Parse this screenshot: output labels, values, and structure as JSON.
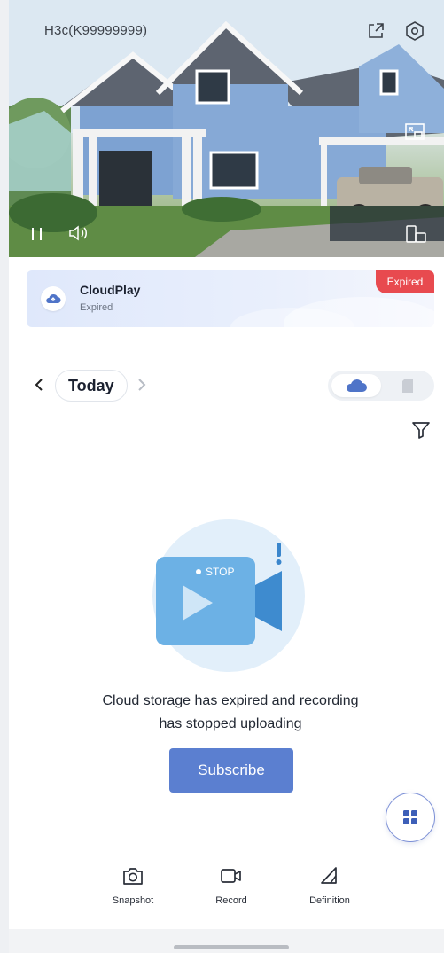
{
  "camera": {
    "title": "H3c(K99999999)",
    "icons": [
      "share-icon",
      "settings-icon",
      "pip-icon",
      "pause-icon",
      "volume-icon",
      "device-switch-icon"
    ]
  },
  "cloud": {
    "title": "CloudPlay",
    "status": "Expired",
    "badge": "Expired"
  },
  "timeline": {
    "date_label": "Today",
    "storage_options": [
      "cloud-icon",
      "sd-card-icon"
    ]
  },
  "empty_state": {
    "illustration_text": "STOP",
    "message_line1": "Cloud storage has expired and recording",
    "message_line2": "has stopped uploading",
    "subscribe_label": "Subscribe"
  },
  "toolbar": {
    "items": [
      {
        "label": "Snapshot",
        "icon": "camera-icon"
      },
      {
        "label": "Record",
        "icon": "video-icon"
      },
      {
        "label": "Definition",
        "icon": "definition-icon"
      }
    ]
  },
  "colors": {
    "accent": "#5b7fd0",
    "badge_red": "#e84a4f",
    "banner_bg": "#e3ebfb"
  }
}
